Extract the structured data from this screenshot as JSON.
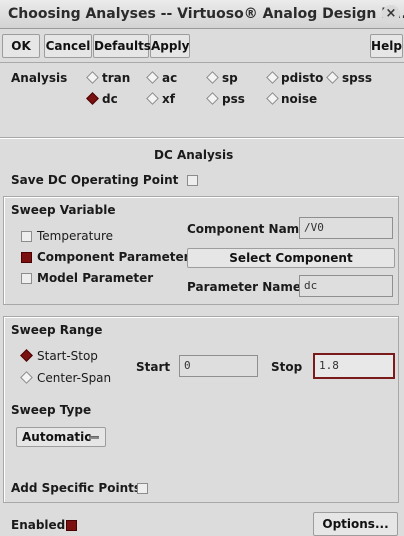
{
  "window": {
    "title": "Choosing Analyses -- Virtuoso® Analog Design E...",
    "close_label": "×"
  },
  "toolbar": {
    "ok": "OK",
    "cancel": "Cancel",
    "defaults": "Defaults",
    "apply": "Apply",
    "help": "Help"
  },
  "analysis": {
    "label": "Analysis",
    "options": [
      {
        "label": "tran",
        "selected": false
      },
      {
        "label": "ac",
        "selected": false
      },
      {
        "label": "sp",
        "selected": false
      },
      {
        "label": "pdisto",
        "selected": false
      },
      {
        "label": "spss",
        "selected": false
      },
      {
        "label": "dc",
        "selected": true
      },
      {
        "label": "xf",
        "selected": false
      },
      {
        "label": "pss",
        "selected": false
      },
      {
        "label": "noise",
        "selected": false
      }
    ]
  },
  "dc": {
    "heading": "DC Analysis",
    "save_op_label": "Save DC Operating Point",
    "sweep_variable": {
      "label": "Sweep Variable",
      "options": [
        {
          "label": "Temperature",
          "checked": false
        },
        {
          "label": "Component Parameter",
          "checked": true
        },
        {
          "label": "Model Parameter",
          "checked": false
        }
      ],
      "component_name_label": "Component Name",
      "component_name_value": "/V0",
      "select_component_label": "Select Component",
      "parameter_name_label": "Parameter Name",
      "parameter_name_value": "dc"
    },
    "sweep_range": {
      "label": "Sweep Range",
      "options": [
        {
          "label": "Start-Stop",
          "selected": true
        },
        {
          "label": "Center-Span",
          "selected": false
        }
      ],
      "start_label": "Start",
      "start_value": "0",
      "stop_label": "Stop",
      "stop_value": "1.8",
      "sweep_type_label": "Sweep Type",
      "sweep_type_value": "Automatic",
      "add_points_label": "Add Specific Points"
    },
    "enabled_label": "Enabled",
    "options_button": "Options..."
  }
}
